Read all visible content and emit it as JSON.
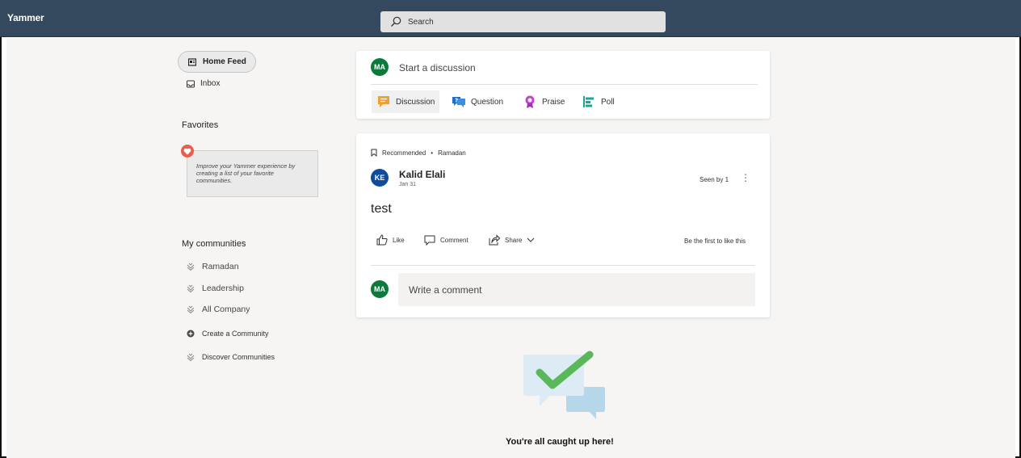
{
  "app": {
    "title": "Yammer"
  },
  "search": {
    "placeholder": "Search"
  },
  "nav": {
    "home_feed": "Home Feed",
    "inbox": "Inbox",
    "favorites_title": "Favorites",
    "favorites_hint": "Improve your Yammer experience by creating a list of your favorite communities.",
    "my_communities_title": "My communities",
    "communities": [
      "Ramadan",
      "Leadership",
      "All Company"
    ],
    "create_community": "Create a Community",
    "discover_communities": "Discover Communities"
  },
  "publisher": {
    "avatar_initials": "MA",
    "placeholder": "Start a discussion",
    "types": [
      "Discussion",
      "Question",
      "Praise",
      "Poll"
    ]
  },
  "post": {
    "recommended": "Recommended",
    "community": "Ramadan",
    "author_initials": "KE",
    "author": "Kalid Elali",
    "date": "Jan 31",
    "seen_by": "Seen by 1",
    "body": "test",
    "actions": {
      "like": "Like",
      "comment": "Comment",
      "share": "Share"
    },
    "like_prompt": "Be the first to like this",
    "comment_avatar_initials": "MA",
    "comment_placeholder": "Write a comment"
  },
  "feed_end": {
    "message": "You're all caught up here!"
  },
  "colors": {
    "topbar": "#35495e",
    "avatar_green": "#0b7a3b",
    "avatar_blue": "#0f4c9c",
    "check_green": "#5cb85c",
    "bubble_blue": "#c8e0ee"
  }
}
